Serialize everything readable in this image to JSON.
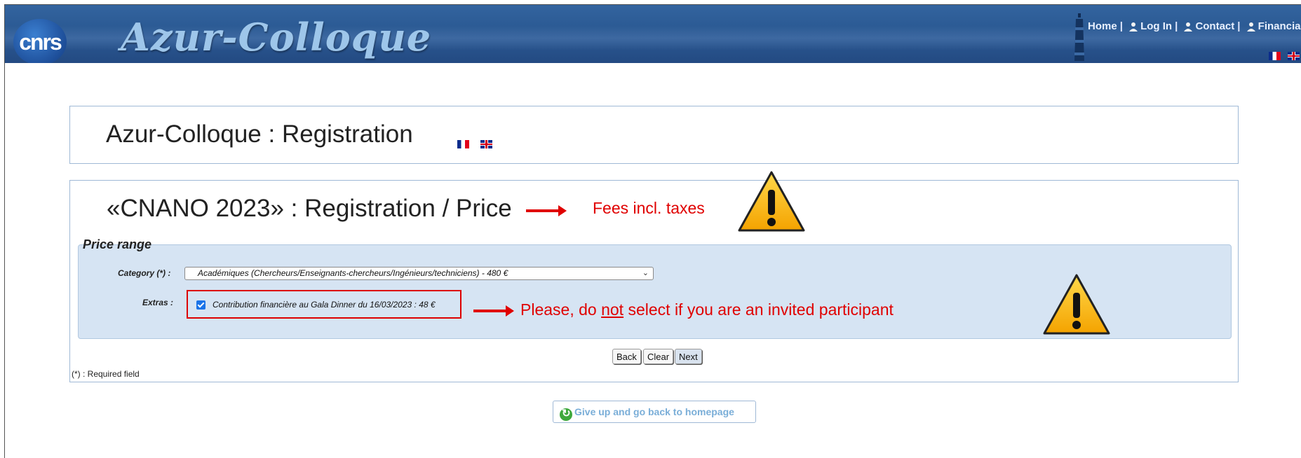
{
  "header": {
    "logo_text": "cnrs",
    "brand": "Azur-Colloque",
    "nav": [
      {
        "label": "Home",
        "icon": "none"
      },
      {
        "label": "Log In",
        "icon": "user-icon"
      },
      {
        "label": "Contact",
        "icon": "user-icon"
      },
      {
        "label": "Financial",
        "icon": "user-icon"
      }
    ],
    "separator": "|"
  },
  "registration": {
    "title": "Azur-Colloque : Registration"
  },
  "price_panel": {
    "title": "«CNANO 2023» : Registration / Price",
    "fees_note": "Fees incl. taxes",
    "legend": "Price range",
    "category_label": "Category (*) :",
    "category_value": "Académiques (Chercheurs/Enseignants-chercheurs/Ingénieurs/techniciens) - 480 €",
    "extras_label": "Extras :",
    "extra_option": "Contribution financière au Gala Dinner du 16/03/2023 : 48 €",
    "extra_checked": true,
    "warning_note_pre": "Please, do ",
    "warning_note_emph": "not",
    "warning_note_post": " select if you are an invited participant"
  },
  "buttons": {
    "back": "Back",
    "clear": "Clear",
    "next": "Next"
  },
  "required_note": "(*) : Required field",
  "give_up": "Give up and go back to homepage",
  "colors": {
    "header": "#2c5b95",
    "annotation": "#e00000",
    "fieldset_bg": "#d6e4f3",
    "panel_border": "#9fb9d6"
  }
}
